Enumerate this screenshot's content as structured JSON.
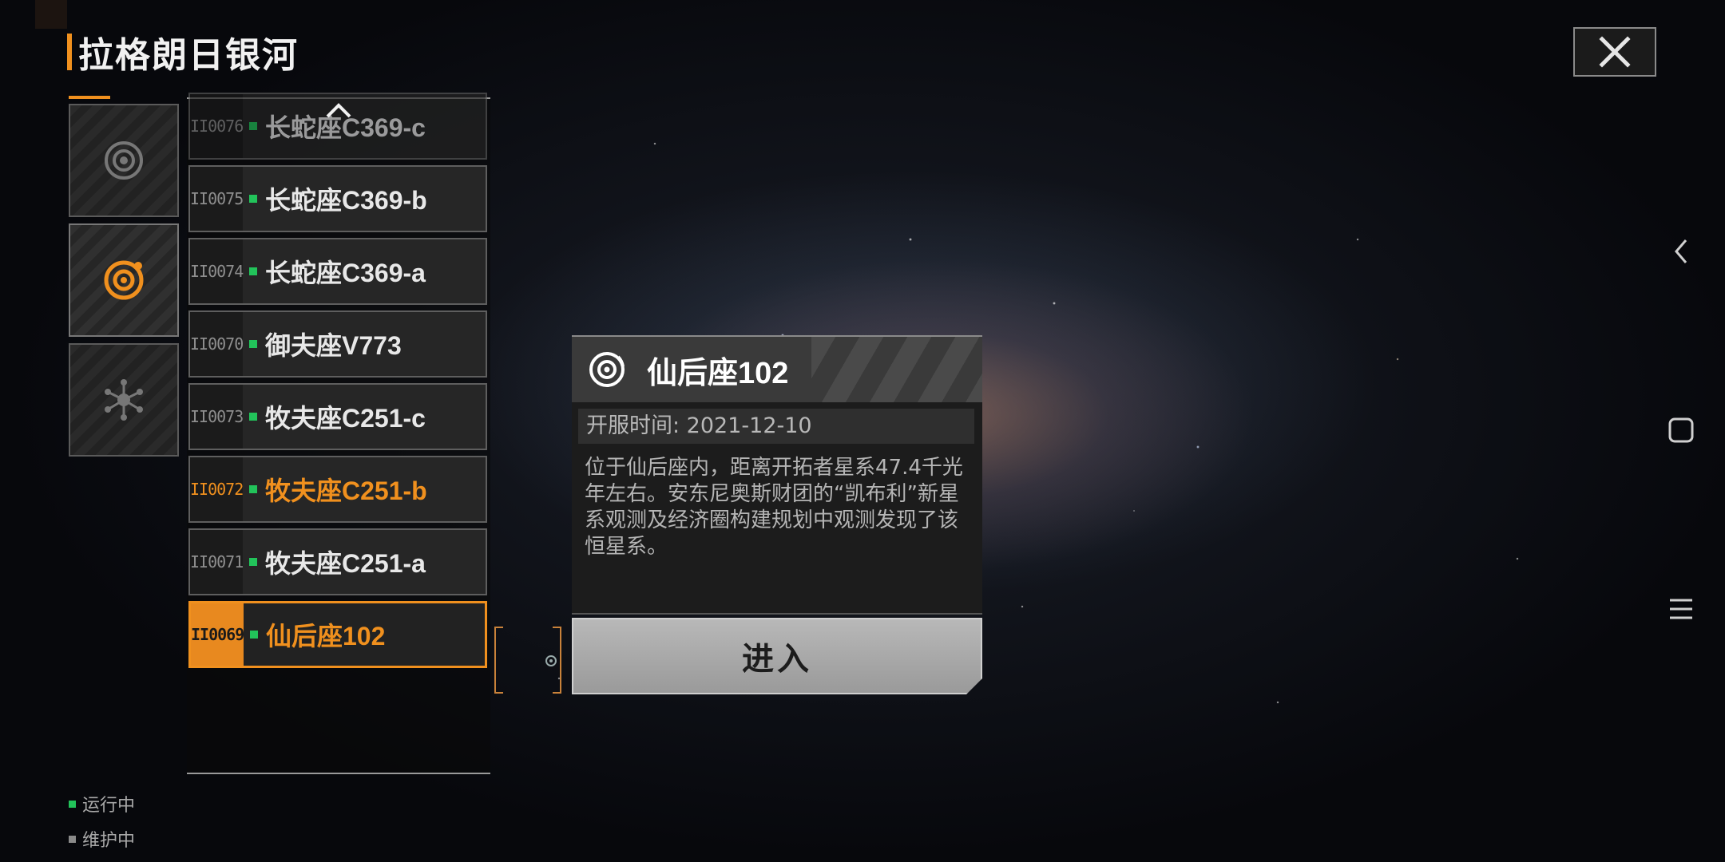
{
  "header": {
    "title": "拉格朗日银河"
  },
  "categories": [
    {
      "icon": "nebula-icon",
      "active": false
    },
    {
      "icon": "orbit-icon",
      "active": true
    },
    {
      "icon": "network-icon",
      "active": false
    }
  ],
  "servers": [
    {
      "code": "II0076",
      "name": "长蛇座C369-c",
      "status": "running",
      "state": "faded"
    },
    {
      "code": "II0075",
      "name": "长蛇座C369-b",
      "status": "running",
      "state": "normal"
    },
    {
      "code": "II0074",
      "name": "长蛇座C369-a",
      "status": "running",
      "state": "normal"
    },
    {
      "code": "II0070",
      "name": "御夫座V773",
      "status": "running",
      "state": "normal"
    },
    {
      "code": "II0073",
      "name": "牧夫座C251-c",
      "status": "running",
      "state": "normal"
    },
    {
      "code": "II0072",
      "name": "牧夫座C251-b",
      "status": "running",
      "state": "hover"
    },
    {
      "code": "II0071",
      "name": "牧夫座C251-a",
      "status": "running",
      "state": "normal"
    },
    {
      "code": "II0069",
      "name": "仙后座102",
      "status": "running",
      "state": "selected"
    }
  ],
  "popup": {
    "name": "仙后座102",
    "open_time": "开服时间: 2021-12-10",
    "description": "位于仙后座内，距离开拓者星系47.4千光年左右。安东尼奥斯财团的“凯布利”新星系观测及经济圈构建规划中观测发现了该恒星系。",
    "enter_label": "进入"
  },
  "legend": {
    "running": "运行中",
    "maintenance": "维护中"
  },
  "colors": {
    "accent": "#f0901e",
    "running": "#22c35a",
    "maintenance": "#8a8a8a"
  }
}
